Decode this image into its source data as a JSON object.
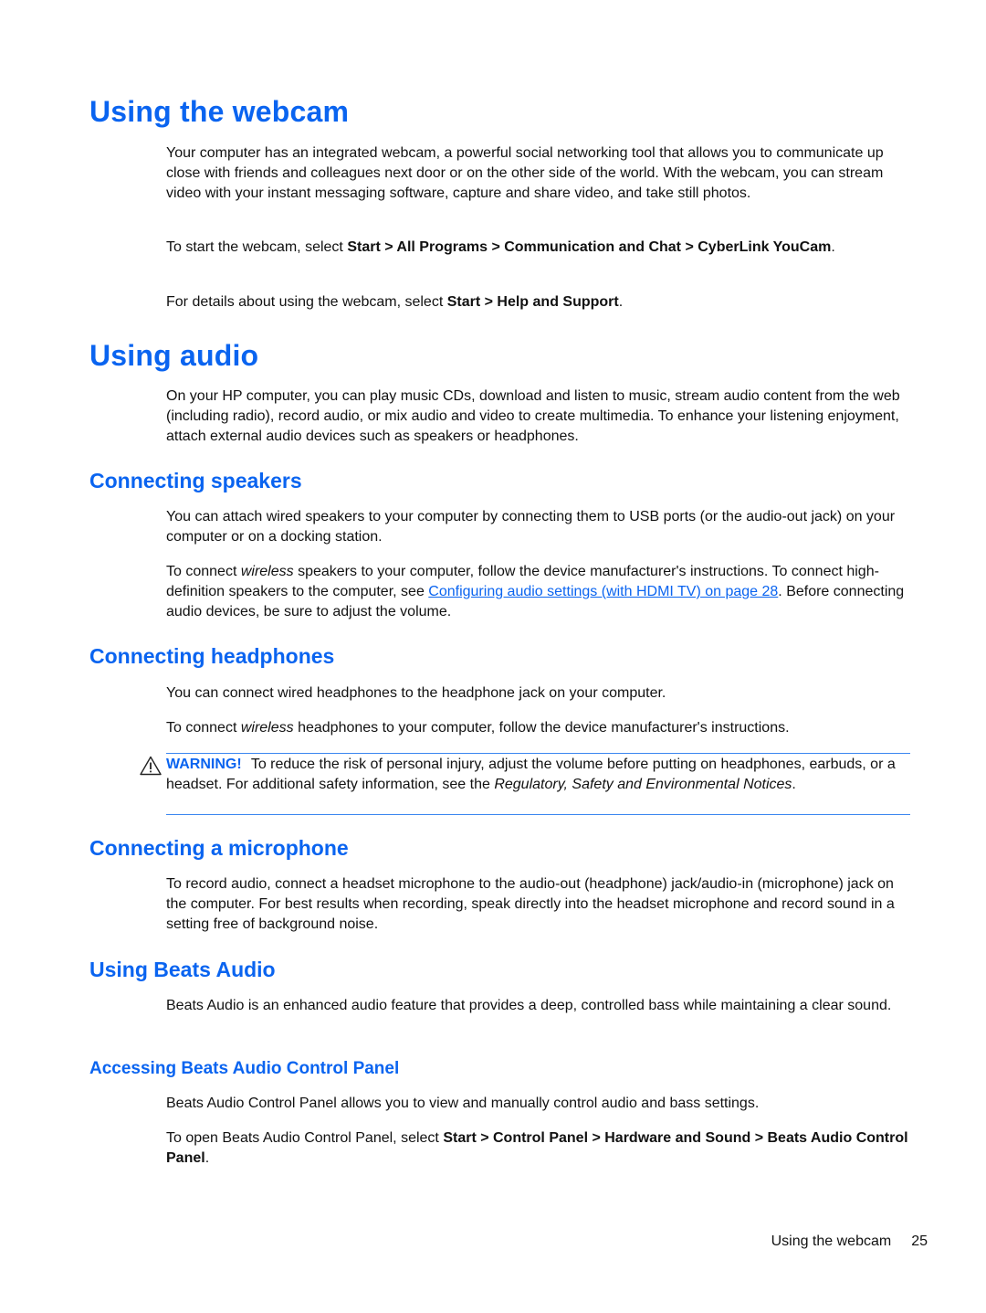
{
  "sections": {
    "webcam": {
      "title": "Using the webcam",
      "p1": "Your computer has an integrated webcam, a powerful social networking tool that allows you to communicate up close with friends and colleagues next door or on the other side of the world. With the webcam, you can stream video with your instant messaging software, capture and share video, and take still photos.",
      "p2_prefix": "To start the webcam, select ",
      "p2_path": "Start > All Programs > Communication and Chat > CyberLink YouCam",
      "p2_suffix": ".",
      "p3_prefix": "For details about using the webcam, select ",
      "p3_path": "Start > Help and Support",
      "p3_suffix": "."
    },
    "audio": {
      "title": "Using audio",
      "p1": "On your HP computer, you can play music CDs, download and listen to music, stream audio content from the web (including radio), record audio, or mix audio and video to create multimedia. To enhance your listening enjoyment, attach external audio devices such as speakers or headphones."
    },
    "speakers": {
      "title": "Connecting speakers",
      "p1": "You can attach wired speakers to your computer by connecting them to USB ports (or the audio-out jack) on your computer or on a docking station.",
      "p2_a": "To connect ",
      "p2_italic": "wireless",
      "p2_b": " speakers to your computer, follow the device manufacturer's instructions. To connect high-definition speakers to the computer, see ",
      "p2_link": "Configuring audio settings (with HDMI TV) on page 28",
      "p2_c": ". Before connecting audio devices, be sure to adjust the volume."
    },
    "headphones": {
      "title": "Connecting headphones",
      "p1": "You can connect wired headphones to the headphone jack on your computer.",
      "p2_a": "To connect ",
      "p2_italic": "wireless",
      "p2_b": " headphones to your computer, follow the device manufacturer's instructions.",
      "warning": {
        "icon": "warning-triangle-icon",
        "label": "WARNING!",
        "text_a": "To reduce the risk of personal injury, adjust the volume before putting on headphones, earbuds, or a headset. For additional safety information, see the ",
        "text_italic": "Regulatory, Safety and Environmental Notices",
        "text_b": "."
      }
    },
    "microphone": {
      "title": "Connecting a microphone",
      "p1": "To record audio, connect a headset microphone to the audio-out (headphone) jack/audio-in (microphone) jack on the computer. For best results when recording, speak directly into the headset microphone and record sound in a setting free of background noise."
    },
    "beats": {
      "title": "Using Beats Audio",
      "p1": "Beats Audio is an enhanced audio feature that provides a deep, controlled bass while maintaining a clear sound."
    },
    "beats_panel": {
      "title": "Accessing Beats Audio Control Panel",
      "p1": "Beats Audio Control Panel allows you to view and manually control audio and bass settings.",
      "p2_prefix": "To open Beats Audio Control Panel, select ",
      "p2_path": "Start > Control Panel > Hardware and Sound > Beats Audio Control Panel",
      "p2_suffix": "."
    }
  },
  "footer": {
    "section": "Using the webcam",
    "page": "25"
  },
  "colors": {
    "heading": "#0a64f0",
    "rule": "#3b86f0",
    "body": "#111111"
  }
}
